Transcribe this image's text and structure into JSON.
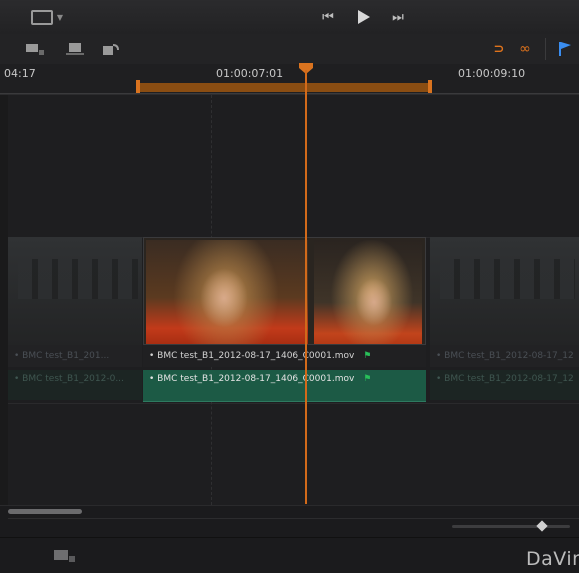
{
  "transport": {
    "rewind_icon": "skip-back-icon",
    "play_icon": "play-icon",
    "forward_icon": "skip-forward-icon"
  },
  "ruler": {
    "tc_left": "04:17",
    "tc_mid": "01:00:07:01",
    "tc_right": "01:00:09:10"
  },
  "clips": {
    "left_video_label": "BMC test_B1_201...",
    "left_audio_label": "BMC test_B1_2012-0...",
    "center_video_label": "BMC test_B1_2012-08-17_1406_C0001.mov",
    "center_audio_label": "BMC test_B1_2012-08-17_1406_C0001.mov",
    "right_video_label": "BMC test_B1_2012-08-17_12",
    "right_audio_label": "BMC test_B1_2012-08-17_12"
  },
  "footer": {
    "brand": "DaVin"
  },
  "colors": {
    "accent_orange": "#d9731f",
    "clip_green": "#1c5a45",
    "flag_blue": "#3a8df0"
  }
}
